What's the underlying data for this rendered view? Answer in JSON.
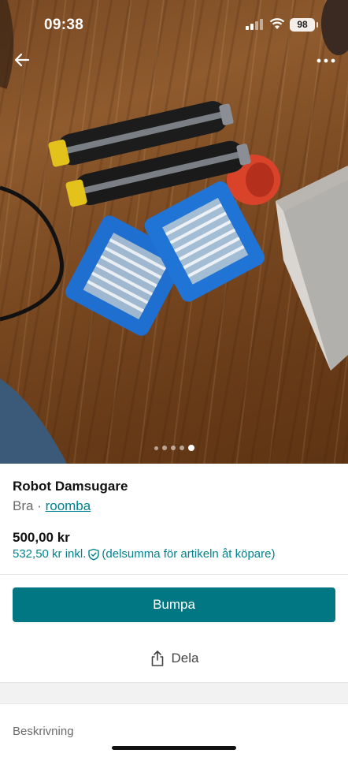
{
  "status_bar": {
    "time": "09:38",
    "battery": "98"
  },
  "nav": {
    "back_icon": "arrow-left-icon",
    "more_icon": "more-horizontal-icon"
  },
  "gallery": {
    "image_count": 5,
    "active_index": 4
  },
  "item": {
    "title": "Robot Damsugare",
    "condition": "Bra",
    "separator": " · ",
    "brand": "roomba",
    "price": "500,00 kr",
    "price_incl": "532,50 kr inkl.",
    "price_incl_note": "(delsumma för artikeln åt köpare)"
  },
  "actions": {
    "bump_label": "Bumpa",
    "share_label": "Dela"
  },
  "description": {
    "heading": "Beskrivning"
  },
  "colors": {
    "accent": "#007782",
    "link": "#00838f"
  }
}
